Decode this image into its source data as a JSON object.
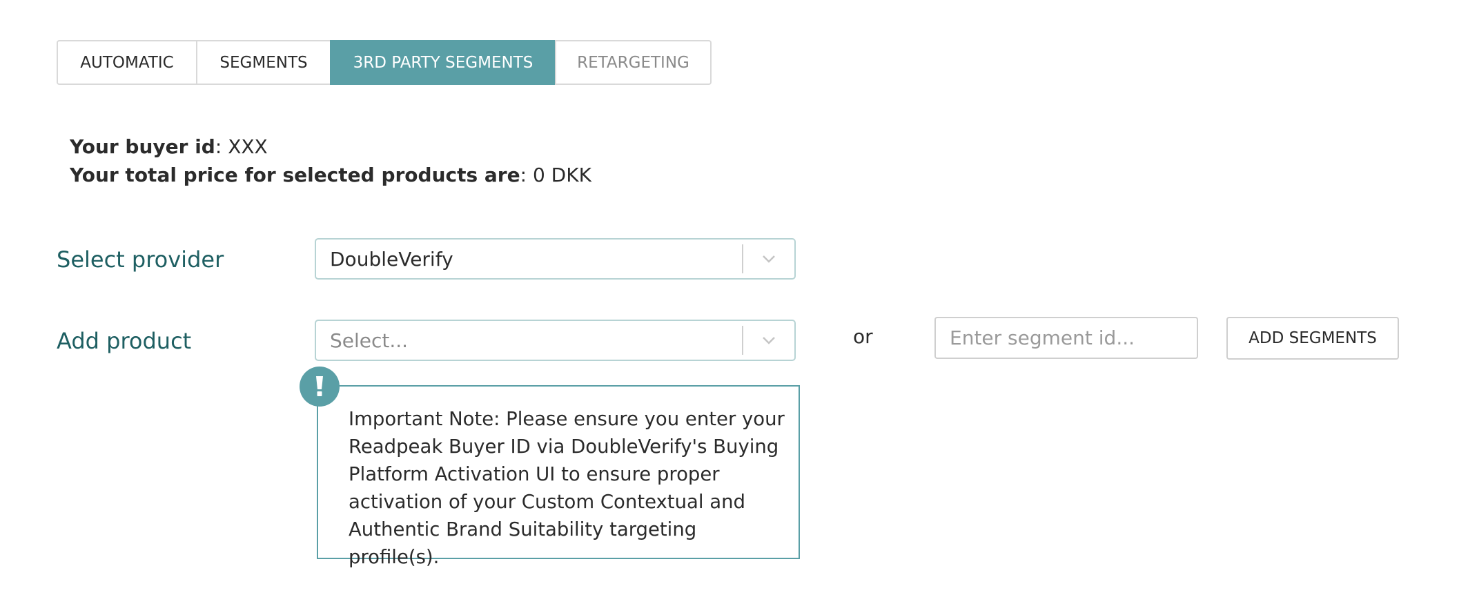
{
  "tabs": [
    {
      "label": "AUTOMATIC",
      "active": false
    },
    {
      "label": "SEGMENTS",
      "active": false
    },
    {
      "label": "3RD PARTY SEGMENTS",
      "active": true
    },
    {
      "label": "RETARGETING",
      "active": false
    }
  ],
  "info": {
    "buyer_id_label": "Your buyer id",
    "buyer_id_value": ": XXX",
    "total_price_label": "Your total price for selected products are",
    "total_price_value": ": 0 DKK"
  },
  "provider": {
    "label": "Select provider",
    "value": "DoubleVerify"
  },
  "product": {
    "label": "Add product",
    "placeholder": "Select...",
    "or_text": "or",
    "segment_input_placeholder": "Enter segment id...",
    "add_button_label": "ADD SEGMENTS"
  },
  "note": {
    "icon": "exclamation-icon",
    "text": "Important Note: Please ensure you enter your Readpeak Buyer ID via DoubleVerify's Buying Platform Activation UI to ensure proper activation of your Custom Contextual and Authentic Brand Suitability targeting profile(s)."
  },
  "colors": {
    "accent": "#5a9fa6",
    "label": "#1e5f62",
    "select_border": "#b7d3d4"
  }
}
